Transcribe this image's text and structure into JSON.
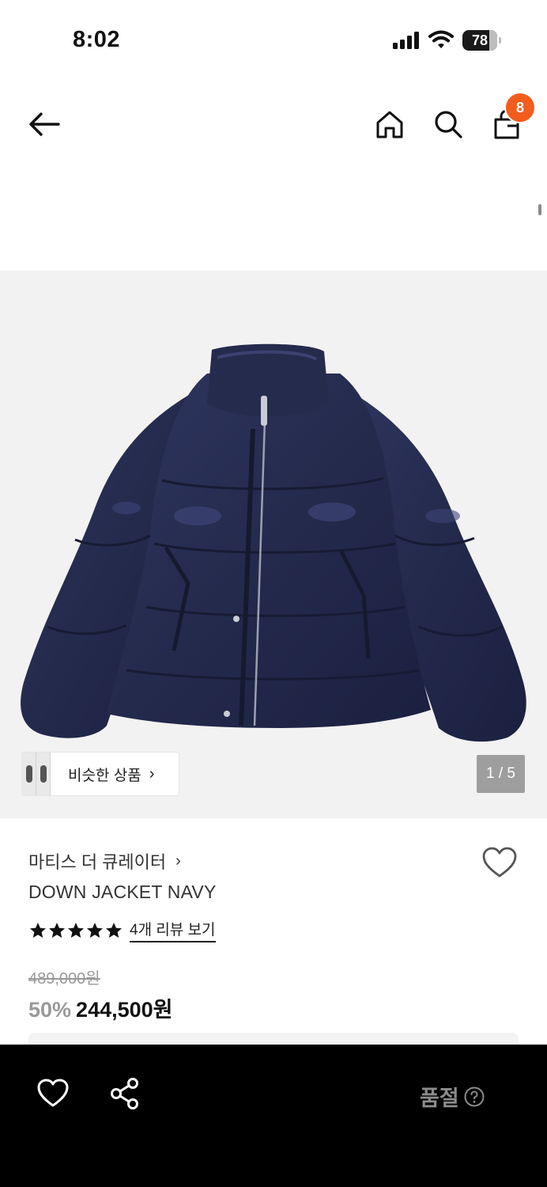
{
  "status_bar": {
    "time": "8:02",
    "battery": "78",
    "battery_level": 0.78
  },
  "header": {
    "cart_badge": "8"
  },
  "gallery": {
    "similar_label": "비슷한 상품",
    "counter": "1 / 5",
    "current_index": 1,
    "total": 5
  },
  "product": {
    "brand": "마티스 더 큐레이터",
    "name": "DOWN JACKET NAVY",
    "rating_stars": 5,
    "review_link": "4개 리뷰 보기",
    "original_price": "489,000원",
    "discount": "50%",
    "sale_price": "244,500원"
  },
  "bottom_bar": {
    "status": "품절"
  },
  "colors": {
    "badge": "#f25c1c",
    "jacket": "#262c4e",
    "bottom_bar": "#000000"
  },
  "icons": [
    "back-arrow-icon",
    "home-icon",
    "search-icon",
    "shopping-bag-icon",
    "heart-icon",
    "share-icon",
    "help-circle-icon",
    "star-icon",
    "chevron-right-icon"
  ]
}
